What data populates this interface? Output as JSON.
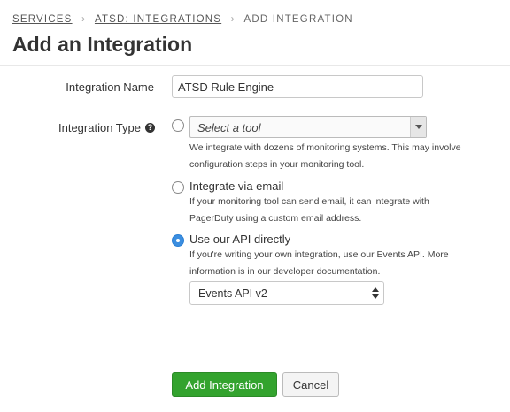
{
  "breadcrumb": {
    "services": "SERVICES",
    "service": "ATSD: INTEGRATIONS",
    "current": "ADD INTEGRATION",
    "separator": "›"
  },
  "page_title": "Add an Integration",
  "form": {
    "name_label": "Integration Name",
    "name_value": "ATSD Rule Engine",
    "type_label": "Integration Type",
    "help_icon": "question-circle-icon",
    "options": {
      "tool": {
        "selected": false,
        "placeholder": "Select a tool",
        "help_line1": "We integrate with dozens of monitoring systems. This may involve",
        "help_line2": "configuration steps in your monitoring tool."
      },
      "email": {
        "selected": false,
        "label": "Integrate via email",
        "help_line1": "If your monitoring tool can send email, it can integrate with",
        "help_line2": "PagerDuty using a custom email address."
      },
      "api": {
        "selected": true,
        "label": "Use our API directly",
        "help_line1": "If you're writing your own integration, use our Events API. More",
        "help_line2": "information is in our developer documentation.",
        "version": "Events API v2"
      }
    }
  },
  "buttons": {
    "submit": "Add Integration",
    "cancel": "Cancel"
  },
  "colors": {
    "primary_button": "#33a32e",
    "radio_selected": "#3b8ee0"
  }
}
